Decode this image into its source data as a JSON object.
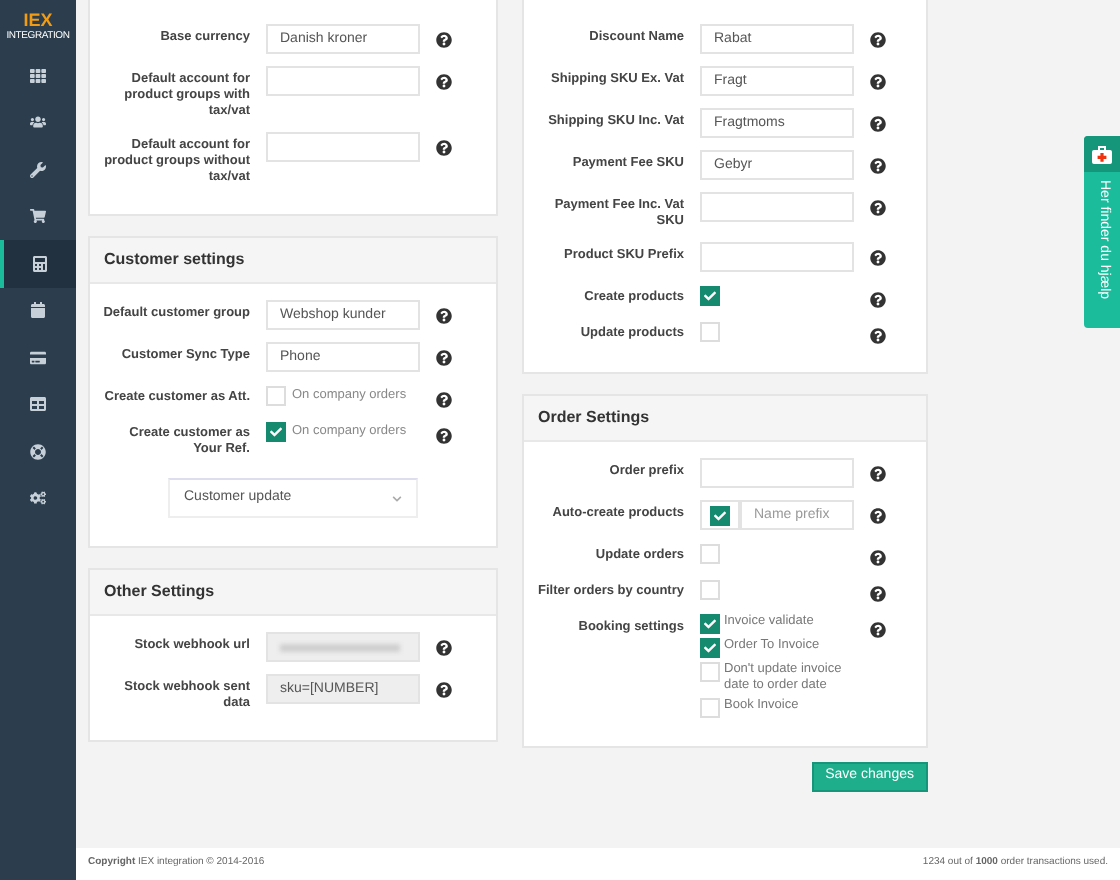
{
  "sidebar": {
    "logo": "IEX",
    "logo_sub": "INTEGRATION",
    "items": [
      {
        "selected": false
      },
      {
        "selected": false
      },
      {
        "selected": false
      },
      {
        "selected": false
      },
      {
        "selected": true
      },
      {
        "selected": false
      },
      {
        "selected": false
      },
      {
        "selected": false
      },
      {
        "selected": false
      },
      {
        "selected": false
      }
    ]
  },
  "columns": [
    {
      "cards": [
        {
          "rows": [
            {
              "kind": "input",
              "label": "Base currency",
              "value": "Danish kroner"
            },
            {
              "kind": "input",
              "label": "Default account for product groups with tax/vat"
            },
            {
              "kind": "input",
              "label": "Default account for product groups without tax/vat"
            }
          ]
        },
        {
          "title": "Customer settings",
          "rows": [
            {
              "kind": "input",
              "label": "Default customer group",
              "value": "Webshop kunder"
            },
            {
              "kind": "input",
              "label": "Customer Sync Type",
              "value": "Phone"
            },
            {
              "kind": "checkbox",
              "label": "Create customer as Att.",
              "text": "On company orders",
              "checked": false
            },
            {
              "kind": "checkbox",
              "label": "Create customer as Your Ref.",
              "text": "On company orders",
              "checked": true
            },
            {
              "kind": "select",
              "value": "Customer update"
            }
          ]
        },
        {
          "title": "Other Settings",
          "rows": [
            {
              "kind": "masked",
              "label": "Stock webhook url"
            },
            {
              "kind": "input",
              "label": "Stock webhook sent data",
              "value": "sku=[NUMBER]",
              "readonly": true
            }
          ]
        }
      ]
    },
    {
      "cards": [
        {
          "rows": [
            {
              "kind": "input",
              "label": "Discount Name",
              "value": "Rabat"
            },
            {
              "kind": "input",
              "label": "Shipping SKU Ex. Vat",
              "value": "Fragt"
            },
            {
              "kind": "input",
              "label": "Shipping SKU Inc. Vat",
              "value": "Fragtmoms"
            },
            {
              "kind": "input",
              "label": "Payment Fee SKU",
              "value": "Gebyr"
            },
            {
              "kind": "input",
              "label": "Payment Fee Inc. Vat SKU"
            },
            {
              "kind": "input",
              "label": "Product SKU Prefix"
            },
            {
              "kind": "checkbox",
              "label": "Create products",
              "checked": true
            },
            {
              "kind": "checkbox",
              "label": "Update products",
              "checked": false
            }
          ]
        },
        {
          "title": "Order Settings",
          "rows": [
            {
              "kind": "input",
              "label": "Order prefix"
            },
            {
              "kind": "checkbox_input",
              "label": "Auto-create products",
              "checked": true,
              "placeholder": "Name prefix"
            },
            {
              "kind": "checkbox",
              "label": "Update orders",
              "checked": false
            },
            {
              "kind": "checkbox",
              "label": "Filter orders by country",
              "checked": false
            },
            {
              "kind": "checklist",
              "label": "Booking settings",
              "options": [
                {
                  "text": "Invoice validate",
                  "checked": true
                },
                {
                  "text": "Order To Invoice",
                  "checked": true
                },
                {
                  "text": "Don't update invoice date to order date",
                  "checked": false
                },
                {
                  "text": "Book Invoice",
                  "checked": false
                }
              ]
            }
          ]
        }
      ],
      "save_button": "Save changes"
    }
  ],
  "help_tab": {
    "label": "Her finder du hjælp"
  },
  "footer": {
    "copyright": "**Copyright** IEX integration © 2014-2016",
    "usage": "1234 out of **1000** order transactions used."
  }
}
